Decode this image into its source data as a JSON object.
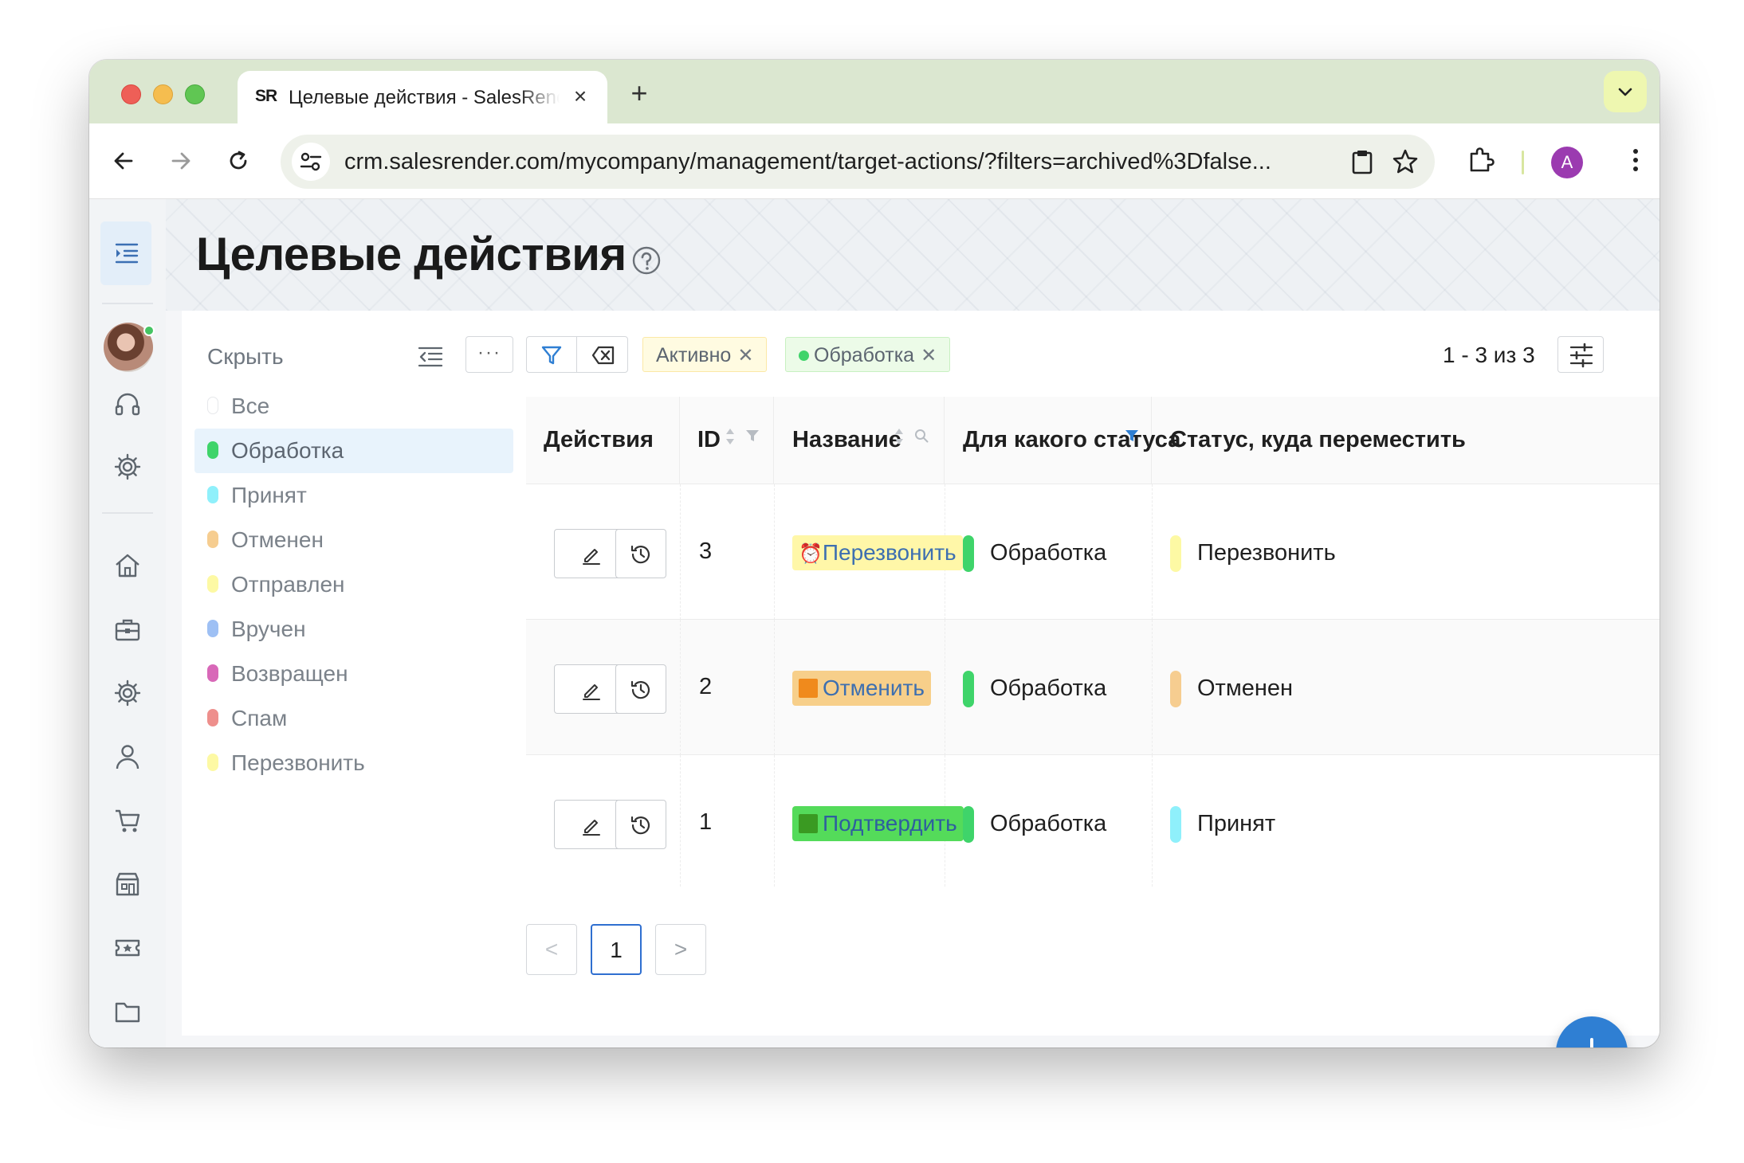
{
  "browser": {
    "tab_favicon_text": "SR",
    "tab_title": "Целевые действия - SalesRender",
    "url": "crm.salesrender.com/mycompany/management/target-actions/?filters=archived%3Dfalse...",
    "profile_initial": "A",
    "accent_color": "#dbe7d0"
  },
  "page": {
    "title": "Целевые действия"
  },
  "sidebar_filter": {
    "hide_label": "Скрыть",
    "statuses": [
      {
        "label": "Все",
        "color": "#ffffff",
        "active": false
      },
      {
        "label": "Обработка",
        "color": "#3fd46a",
        "active": true
      },
      {
        "label": "Принят",
        "color": "#8ff0fb",
        "active": false
      },
      {
        "label": "Отменен",
        "color": "#f6cd90",
        "active": false
      },
      {
        "label": "Отправлен",
        "color": "#fdf9a4",
        "active": false
      },
      {
        "label": "Вручен",
        "color": "#9ec0f4",
        "active": false
      },
      {
        "label": "Возвращен",
        "color": "#d868b8",
        "active": false
      },
      {
        "label": "Спам",
        "color": "#ee8f8c",
        "active": false
      },
      {
        "label": "Перезвонить",
        "color": "#fdf9a4",
        "active": false
      }
    ]
  },
  "filters": {
    "more_label": "···",
    "chips": [
      {
        "label": "Активно",
        "close": "✕"
      },
      {
        "label": "Обработка",
        "close": "✕"
      }
    ],
    "count_text": "1 - 3 из 3"
  },
  "table": {
    "columns": [
      "Действия",
      "ID",
      "Название",
      "Для какого статуса",
      "Статус, куда переместить"
    ],
    "rows": [
      {
        "id": "3",
        "name": "Перезвонить",
        "name_icon": "alarm-clock-icon",
        "for_status": "Обработка",
        "for_color": "#3fd46a",
        "target_status": "Перезвонить",
        "target_color": "#fdf9a4"
      },
      {
        "id": "2",
        "name": "Отменить",
        "name_icon": "orange-square-icon",
        "for_status": "Обработка",
        "for_color": "#3fd46a",
        "target_status": "Отменен",
        "target_color": "#f6cd90"
      },
      {
        "id": "1",
        "name": "Подтвердить",
        "name_icon": "green-square-icon",
        "for_status": "Обработка",
        "for_color": "#3fd46a",
        "target_status": "Принят",
        "target_color": "#8ff0fb"
      }
    ]
  },
  "pagination": {
    "prev": "<",
    "current": "1",
    "next": ">"
  }
}
